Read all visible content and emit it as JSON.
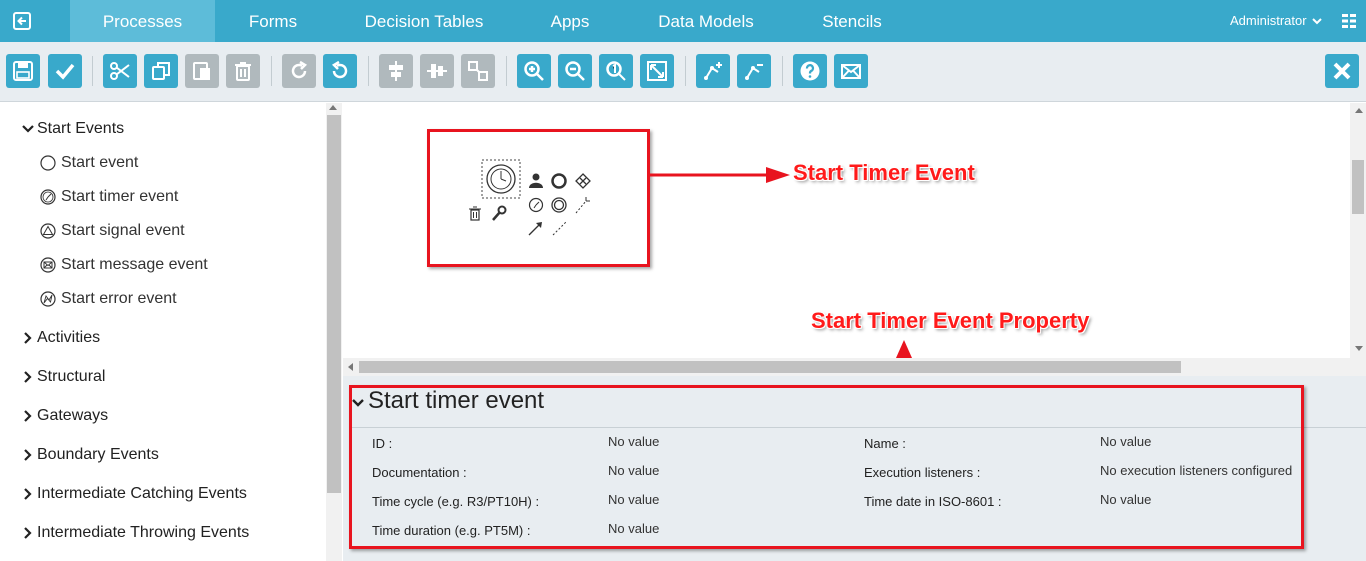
{
  "nav": {
    "tabs": [
      "Processes",
      "Forms",
      "Decision Tables",
      "Apps",
      "Data Models",
      "Stencils"
    ],
    "active": "Processes",
    "user": "Administrator"
  },
  "toolbar": {
    "buttons": [
      "save-icon",
      "validate-icon",
      "cut-icon",
      "copy-icon",
      "paste-icon",
      "delete-icon",
      "redo-icon",
      "undo-icon",
      "align-horizontal-icon",
      "align-vertical-icon",
      "same-size-icon",
      "zoom-in-icon",
      "zoom-out-icon",
      "zoom-actual-icon",
      "zoom-fit-icon",
      "bendpoint-add-icon",
      "bendpoint-remove-icon",
      "help-icon",
      "email-icon",
      "close-icon"
    ]
  },
  "sidebar": {
    "expanded_group": "Start Events",
    "items": [
      "Start event",
      "Start timer event",
      "Start signal event",
      "Start message event",
      "Start error event"
    ],
    "groups": [
      "Activities",
      "Structural",
      "Gateways",
      "Boundary Events",
      "Intermediate Catching Events",
      "Intermediate Throwing Events"
    ]
  },
  "annotations": {
    "timer_callout": "Start Timer Event",
    "property_callout": "Start Timer Event Property"
  },
  "properties": {
    "title": "Start timer event",
    "fields": {
      "id_label": "ID :",
      "id_value": "No value",
      "name_label": "Name :",
      "name_value": "No value",
      "documentation_label": "Documentation :",
      "documentation_value": "No value",
      "execution_listeners_label": "Execution listeners :",
      "execution_listeners_value": "No execution listeners configured",
      "time_cycle_label": "Time cycle (e.g. R3/PT10H) :",
      "time_cycle_value": "No value",
      "time_date_label": "Time date in ISO-8601 :",
      "time_date_value": "No value",
      "time_duration_label": "Time duration (e.g. PT5M) :",
      "time_duration_value": "No value"
    }
  },
  "colors": {
    "nav_bg": "#39a9cb",
    "nav_active": "#5dbcd9",
    "button": "#39a9cb",
    "button_disabled": "#b0b9bd",
    "annotation_red": "#e8141f"
  }
}
